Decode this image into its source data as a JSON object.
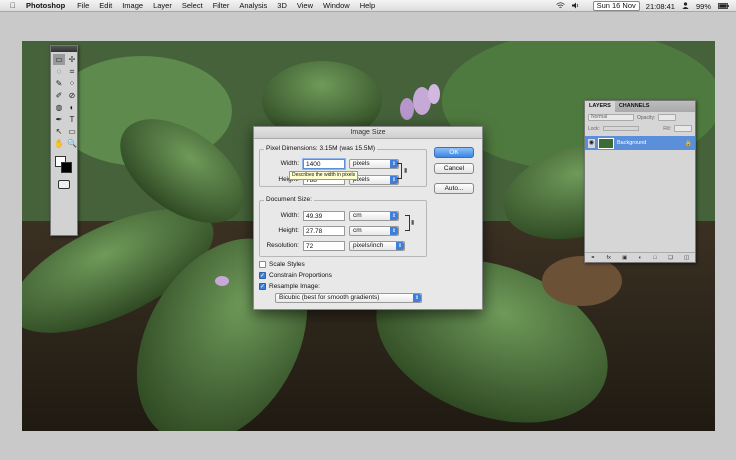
{
  "menubar": {
    "app": "Photoshop",
    "items": [
      "File",
      "Edit",
      "Image",
      "Layer",
      "Select",
      "Filter",
      "Analysis",
      "3D",
      "View",
      "Window",
      "Help"
    ],
    "date": "Sun 16 Nov",
    "time": "21:08:41",
    "battery": "99%"
  },
  "tools": {
    "glyphs": [
      "▭",
      "✢",
      "◌",
      "⌗",
      "✎",
      "⁘",
      "✐",
      "⊘",
      "◍",
      "◐",
      "✒",
      "T",
      "↖",
      "▭",
      "✋",
      "🔍"
    ]
  },
  "layers_panel": {
    "tabs": [
      "LAYERS",
      "CHANNELS"
    ],
    "blend_mode": "Normal",
    "opacity_label": "Opacity:",
    "lock_label": "Lock:",
    "fill_label": "Fill:",
    "layer_name": "Background",
    "footer_icons": [
      "link-icon",
      "fx-icon",
      "mask-icon",
      "adjustment-icon",
      "group-icon",
      "new-layer-icon",
      "trash-icon"
    ]
  },
  "dialog": {
    "title": "Image Size",
    "pixel_dimensions": {
      "label": "Pixel Dimensions:  3.15M (was 15.5M)",
      "width_label": "Width:",
      "width_value": "1400",
      "width_unit": "pixels",
      "height_label": "Height:",
      "height_value": "788",
      "height_unit": "pixels",
      "tooltip": "Describes the width in pixels"
    },
    "document_size": {
      "label": "Document Size:",
      "width_label": "Width:",
      "width_value": "49.39",
      "width_unit": "cm",
      "height_label": "Height:",
      "height_value": "27.78",
      "height_unit": "cm",
      "resolution_label": "Resolution:",
      "resolution_value": "72",
      "resolution_unit": "pixels/inch"
    },
    "checkboxes": {
      "scale_styles": "Scale Styles",
      "constrain": "Constrain Proportions",
      "resample": "Resample Image:"
    },
    "resample_method": "Bicubic (best for smooth gradients)",
    "buttons": {
      "ok": "OK",
      "cancel": "Cancel",
      "auto": "Auto..."
    }
  }
}
